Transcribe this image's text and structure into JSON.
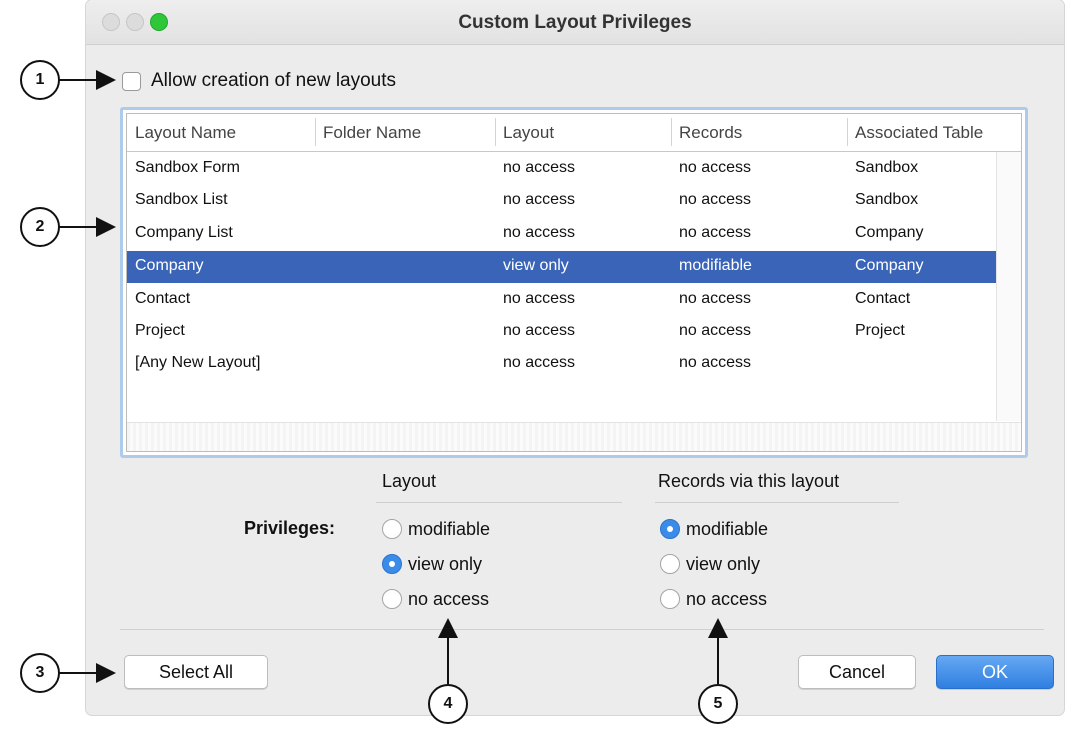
{
  "window": {
    "title": "Custom Layout Privileges"
  },
  "allow_new_layouts": {
    "label": "Allow creation of new layouts",
    "checked": false
  },
  "table": {
    "columns": [
      "Layout Name",
      "Folder Name",
      "Layout",
      "Records",
      "Associated Table"
    ],
    "rows": [
      {
        "layout_name": "Sandbox Form",
        "folder_name": "",
        "layout": "no access",
        "records": "no access",
        "associated_table": "Sandbox",
        "selected": false
      },
      {
        "layout_name": "Sandbox List",
        "folder_name": "",
        "layout": "no access",
        "records": "no access",
        "associated_table": "Sandbox",
        "selected": false
      },
      {
        "layout_name": "Company List",
        "folder_name": "",
        "layout": "no access",
        "records": "no access",
        "associated_table": "Company",
        "selected": false
      },
      {
        "layout_name": "Company",
        "folder_name": "",
        "layout": "view only",
        "records": "modifiable",
        "associated_table": "Company",
        "selected": true
      },
      {
        "layout_name": "Contact",
        "folder_name": "",
        "layout": "no access",
        "records": "no access",
        "associated_table": "Contact",
        "selected": false
      },
      {
        "layout_name": "Project",
        "folder_name": "",
        "layout": "no access",
        "records": "no access",
        "associated_table": "Project",
        "selected": false
      },
      {
        "layout_name": "[Any New Layout]",
        "folder_name": "",
        "layout": "no access",
        "records": "no access",
        "associated_table": "",
        "selected": false
      }
    ]
  },
  "privileges": {
    "label": "Privileges:",
    "layout_group": {
      "header": "Layout",
      "options": [
        "modifiable",
        "view only",
        "no access"
      ],
      "selected": "view only"
    },
    "records_group": {
      "header": "Records via this layout",
      "options": [
        "modifiable",
        "view only",
        "no access"
      ],
      "selected": "modifiable"
    }
  },
  "buttons": {
    "select_all": "Select All",
    "cancel": "Cancel",
    "ok": "OK"
  },
  "callouts": [
    "1",
    "2",
    "3",
    "4",
    "5"
  ],
  "colors": {
    "selection": "#3a64b8",
    "accent": "#3a8ce8",
    "close_green": "#2ec73a"
  }
}
